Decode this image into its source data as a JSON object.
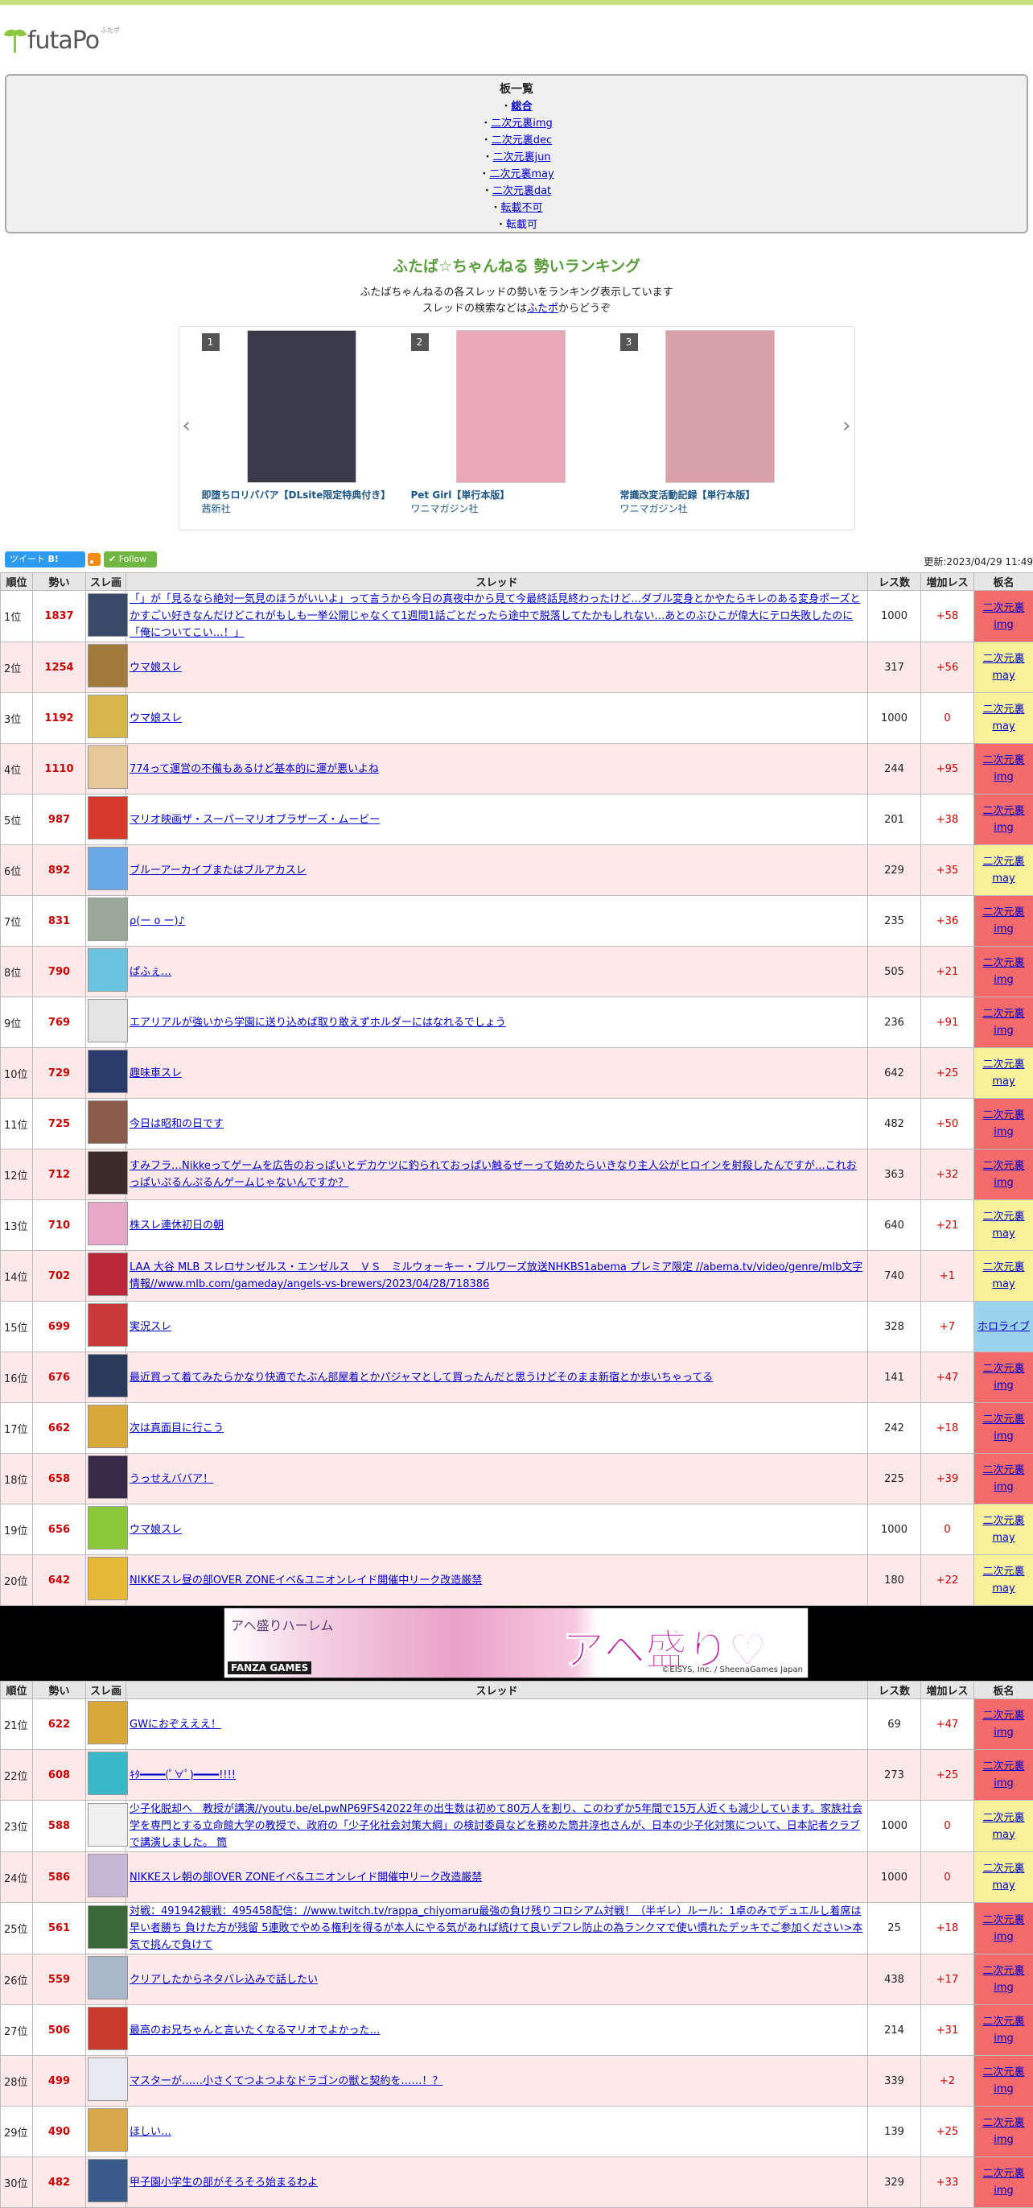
{
  "logo": {
    "name": "futaPo",
    "sub": "ふたポ"
  },
  "boards": {
    "title": "板一覧",
    "items": [
      "総合",
      "二次元裏img",
      "二次元裏dec",
      "二次元裏jun",
      "二次元裏may",
      "二次元裏dat",
      "転載不可",
      "転載可"
    ]
  },
  "header": {
    "title": "ふたば☆ちゃんねる 勢いランキング",
    "line1": "ふたばちゃんねるの各スレッドの勢いをランキング表示しています",
    "line2_pre": "スレッドの検索などは",
    "line2_link": "ふたポ",
    "line2_post": "からどうぞ"
  },
  "carousel": {
    "items": [
      {
        "num": "1",
        "title": "即堕ちロリババア【DLsite限定特典付き】",
        "publisher": "茜新社"
      },
      {
        "num": "2",
        "title": "Pet Girl【単行本版】",
        "publisher": "ワニマガジン社"
      },
      {
        "num": "3",
        "title": "常識改変活動記録【単行本版】",
        "publisher": "ワニマガジン社"
      }
    ]
  },
  "share": {
    "tweet": "ツイート",
    "hatena": "B!",
    "follow": "Follow",
    "updated": "更新:2023/04/29 11:49"
  },
  "table_headers": [
    "順位",
    "勢い",
    "スレ画",
    "スレッド",
    "レス数",
    "増加レス",
    "板名"
  ],
  "rows1": [
    {
      "rank": "1位",
      "ikioi": "1837",
      "title": "「」が「見るなら絶対一気見のほうがいいよ」って言うから今日の真夜中から見て今最終話見終わったけど…ダブル変身とかやたらキレのある変身ポーズとかすごい好きなんだけどこれがもしも一挙公開じゃなくて1週間1話ごとだったら途中で脱落してたかもしれない…あとのぶひこが偉大にテロ失敗したのに「俺についてこい…！」",
      "res": "1000",
      "inc": "+58",
      "board": "二次元裏img",
      "kind": "img",
      "color": "#3a4a6b"
    },
    {
      "rank": "2位",
      "ikioi": "1254",
      "title": "ウマ娘スレ",
      "res": "317",
      "inc": "+56",
      "board": "二次元裏may",
      "kind": "may",
      "color": "#a07a3a"
    },
    {
      "rank": "3位",
      "ikioi": "1192",
      "title": "ウマ娘スレ",
      "res": "1000",
      "inc": "0",
      "board": "二次元裏may",
      "kind": "may",
      "color": "#d6b84a"
    },
    {
      "rank": "4位",
      "ikioi": "1110",
      "title": "774って運営の不備もあるけど基本的に運が悪いよね",
      "res": "244",
      "inc": "+95",
      "board": "二次元裏img",
      "kind": "img",
      "color": "#e8c89a"
    },
    {
      "rank": "5位",
      "ikioi": "987",
      "title": "マリオ映画ザ・スーパーマリオブラザーズ・ムービー",
      "res": "201",
      "inc": "+38",
      "board": "二次元裏img",
      "kind": "img",
      "color": "#d33a2a"
    },
    {
      "rank": "6位",
      "ikioi": "892",
      "title": "ブルーアーカイブまたはブルアカスレ",
      "res": "229",
      "inc": "+35",
      "board": "二次元裏may",
      "kind": "may",
      "color": "#6aa8e8"
    },
    {
      "rank": "7位",
      "ikioi": "831",
      "title": "ρ(ー o ー)♪",
      "res": "235",
      "inc": "+36",
      "board": "二次元裏img",
      "kind": "img",
      "color": "#9aa89a"
    },
    {
      "rank": "8位",
      "ikioi": "790",
      "title": "ぱふぇ…",
      "res": "505",
      "inc": "+21",
      "board": "二次元裏img",
      "kind": "img",
      "color": "#6ac4e0"
    },
    {
      "rank": "9位",
      "ikioi": "769",
      "title": "エアリアルが強いから学園に送り込めば取り敢えずホルダーにはなれるでしょう",
      "res": "236",
      "inc": "+91",
      "board": "二次元裏img",
      "kind": "img",
      "color": "#e4e4e4"
    },
    {
      "rank": "10位",
      "ikioi": "729",
      "title": "趣味車スレ",
      "res": "642",
      "inc": "+25",
      "board": "二次元裏may",
      "kind": "may",
      "color": "#2a3a6a"
    },
    {
      "rank": "11位",
      "ikioi": "725",
      "title": "今日は昭和の日です",
      "res": "482",
      "inc": "+50",
      "board": "二次元裏img",
      "kind": "img",
      "color": "#8a5a4a"
    },
    {
      "rank": "12位",
      "ikioi": "712",
      "title": "すみフラ…Nikkeってゲームを広告のおっぱいとデカケツに釣られておっぱい触るぜーって始めたらいきなり主人公がヒロインを射殺したんですが…これおっぱいぷるんぷるんゲームじゃないんですか？",
      "res": "363",
      "inc": "+32",
      "board": "二次元裏img",
      "kind": "img",
      "color": "#3a2a2a"
    },
    {
      "rank": "13位",
      "ikioi": "710",
      "title": "株スレ連休初日の朝",
      "res": "640",
      "inc": "+21",
      "board": "二次元裏may",
      "kind": "may",
      "color": "#e8a8c8"
    },
    {
      "rank": "14位",
      "ikioi": "702",
      "title": "LAA 大谷 MLB スレロサンゼルス・エンゼルス　ＶＳ　ミルウォーキー・ブルワーズ放送NHKBS1abema プレミア限定 //abema.tv/video/genre/mlb文字情報//www.mlb.com/gameday/angels-vs-brewers/2023/04/28/718386",
      "res": "740",
      "inc": "+1",
      "board": "二次元裏may",
      "kind": "may",
      "color": "#b8283a"
    },
    {
      "rank": "15位",
      "ikioi": "699",
      "title": "実況スレ",
      "res": "328",
      "inc": "+7",
      "board": "ホロライブ",
      "kind": "holo",
      "color": "#c83a3a"
    },
    {
      "rank": "16位",
      "ikioi": "676",
      "title": "最近買って着てみたらかなり快適でたぶん部屋着とかパジャマとして買ったんだと思うけどそのまま新宿とか歩いちゃってる",
      "res": "141",
      "inc": "+47",
      "board": "二次元裏img",
      "kind": "img",
      "color": "#2a3a5a"
    },
    {
      "rank": "17位",
      "ikioi": "662",
      "title": "次は真面目に行こう",
      "res": "242",
      "inc": "+18",
      "board": "二次元裏img",
      "kind": "img",
      "color": "#d8a83a"
    },
    {
      "rank": "18位",
      "ikioi": "658",
      "title": "うっせえババア！",
      "res": "225",
      "inc": "+39",
      "board": "二次元裏img",
      "kind": "img",
      "color": "#3a2a4a"
    },
    {
      "rank": "19位",
      "ikioi": "656",
      "title": "ウマ娘スレ",
      "res": "1000",
      "inc": "0",
      "board": "二次元裏may",
      "kind": "may",
      "color": "#8ac83a"
    },
    {
      "rank": "20位",
      "ikioi": "642",
      "title": "NIKKEスレ昼の部OVER ZONEイベ&ユニオンレイド開催中リーク改造厳禁",
      "res": "180",
      "inc": "+22",
      "board": "二次元裏may",
      "kind": "may",
      "color": "#e8b83a"
    }
  ],
  "ad": {
    "brand": "アヘ盛りハーレム",
    "catch": "アヘ盛り♡",
    "maker": "FANZA GAMES",
    "copy": "©EISYS, Inc. / SheenaGames Japan"
  },
  "rows2": [
    {
      "rank": "21位",
      "ikioi": "622",
      "title": "GWにおぞえええ！",
      "res": "69",
      "inc": "+47",
      "board": "二次元裏img",
      "kind": "img",
      "color": "#d8a83a"
    },
    {
      "rank": "22位",
      "ikioi": "608",
      "title": "ｷﾀ━━━━(ﾟ∀ﾟ)━━━━!!!!",
      "res": "273",
      "inc": "+25",
      "board": "二次元裏img",
      "kind": "img",
      "color": "#3ab8c8"
    },
    {
      "rank": "23位",
      "ikioi": "588",
      "title": "少子化脱却へ　教授が講演//youtu.be/eLpwNP69FS42022年の出生数は初めて80万人を割り、このわずか5年間で15万人近くも減少しています。家族社会学を専門とする立命館大学の教授で、政府の「少子化社会対策大綱」の検討委員などを務めた筒井淳也さんが、日本の少子化対策について、日本記者クラブで講演しました。 筒",
      "res": "1000",
      "inc": "0",
      "board": "二次元裏may",
      "kind": "may",
      "color": "#f0f0f0"
    },
    {
      "rank": "24位",
      "ikioi": "586",
      "title": "NIKKEスレ朝の部OVER ZONEイベ&ユニオンレイド開催中リーク改造厳禁",
      "res": "1000",
      "inc": "0",
      "board": "二次元裏may",
      "kind": "may",
      "color": "#c8b8d8"
    },
    {
      "rank": "25位",
      "ikioi": "561",
      "title": "対戦：491942観戦：495458配信：//www.twitch.tv/rappa_chiyomaru最強の負け残りコロシアム対戦！（半ギレ）ルール：1卓のみでデュエルし着席は早い者勝ち 負けた方が残留 5連敗でやめる権利を得るが本人にやる気があれば続けて良いデフレ防止の為ランクマで使い慣れたデッキでご参加ください>本気で挑んで負けて",
      "res": "25",
      "inc": "+18",
      "board": "二次元裏img",
      "kind": "img",
      "color": "#3a6a3a"
    },
    {
      "rank": "26位",
      "ikioi": "559",
      "title": "クリアしたからネタバレ込みで話したい",
      "res": "438",
      "inc": "+17",
      "board": "二次元裏img",
      "kind": "img",
      "color": "#a8b8c8"
    },
    {
      "rank": "27位",
      "ikioi": "506",
      "title": "最高のお兄ちゃんと言いたくなるマリオでよかった…",
      "res": "214",
      "inc": "+31",
      "board": "二次元裏img",
      "kind": "img",
      "color": "#c83a2a"
    },
    {
      "rank": "28位",
      "ikioi": "499",
      "title": "マスターが……小さくてつよつよなドラゴンの獣と契約を……！？",
      "res": "339",
      "inc": "+2",
      "board": "二次元裏img",
      "kind": "img",
      "color": "#e8e8f0"
    },
    {
      "rank": "29位",
      "ikioi": "490",
      "title": "ほしい…",
      "res": "139",
      "inc": "+25",
      "board": "二次元裏img",
      "kind": "img",
      "color": "#d8a84a"
    },
    {
      "rank": "30位",
      "ikioi": "482",
      "title": "甲子園小学生の部がそろそろ始まるわよ",
      "res": "329",
      "inc": "+33",
      "board": "二次元裏img",
      "kind": "img",
      "color": "#3a5a8a"
    }
  ]
}
